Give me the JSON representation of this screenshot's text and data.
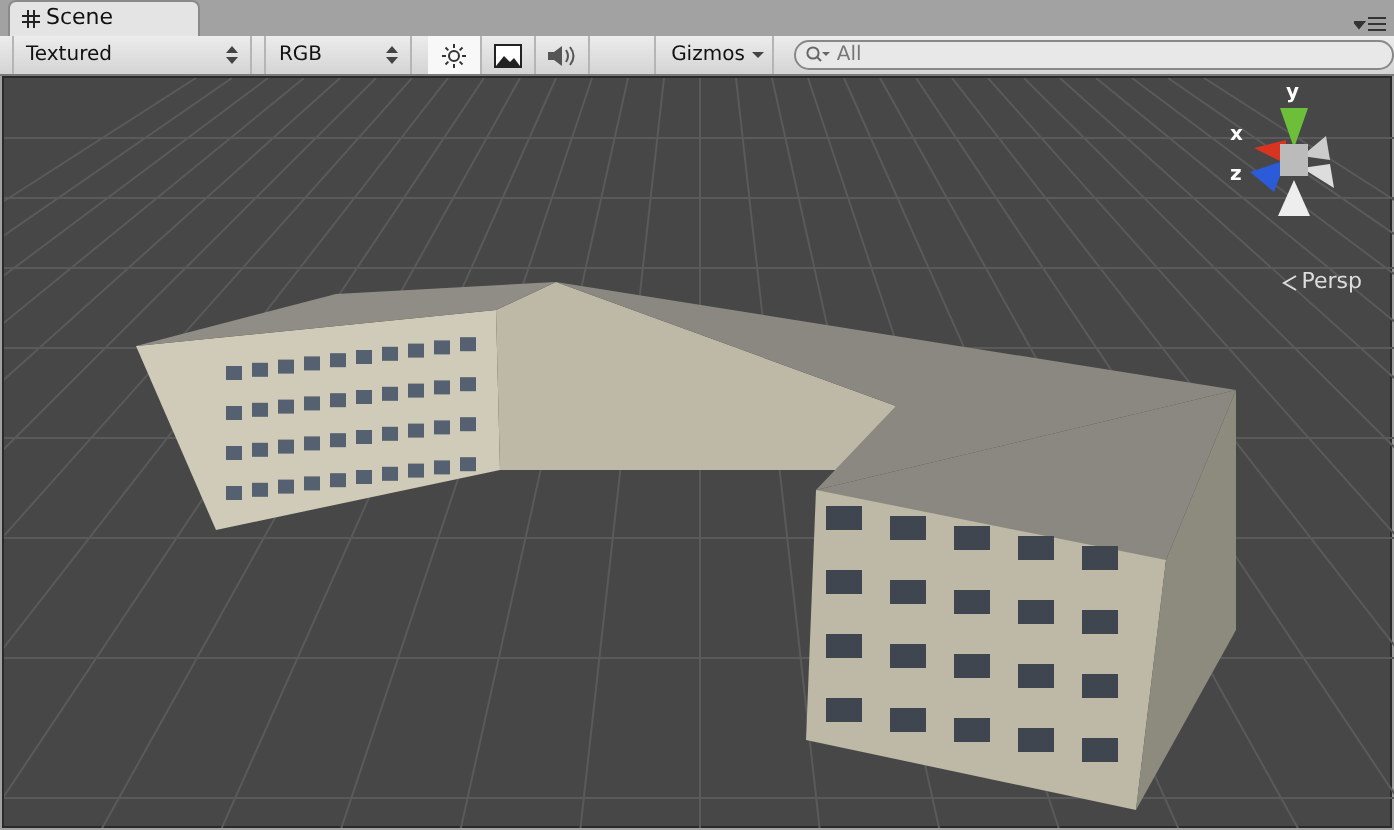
{
  "tab": {
    "title": "Scene"
  },
  "toolbar": {
    "render_mode": "Textured",
    "color_mode": "RGB",
    "toggles": [
      {
        "kind": "lighting",
        "selected": true
      },
      {
        "kind": "image",
        "selected": false
      },
      {
        "kind": "audio",
        "selected": false
      }
    ],
    "gizmos": "Gizmos",
    "search": {
      "placeholder": "All"
    }
  },
  "viewport": {
    "axes": [
      {
        "label": "y"
      },
      {
        "label": "x"
      },
      {
        "label": "z"
      }
    ],
    "projection": "Persp"
  }
}
